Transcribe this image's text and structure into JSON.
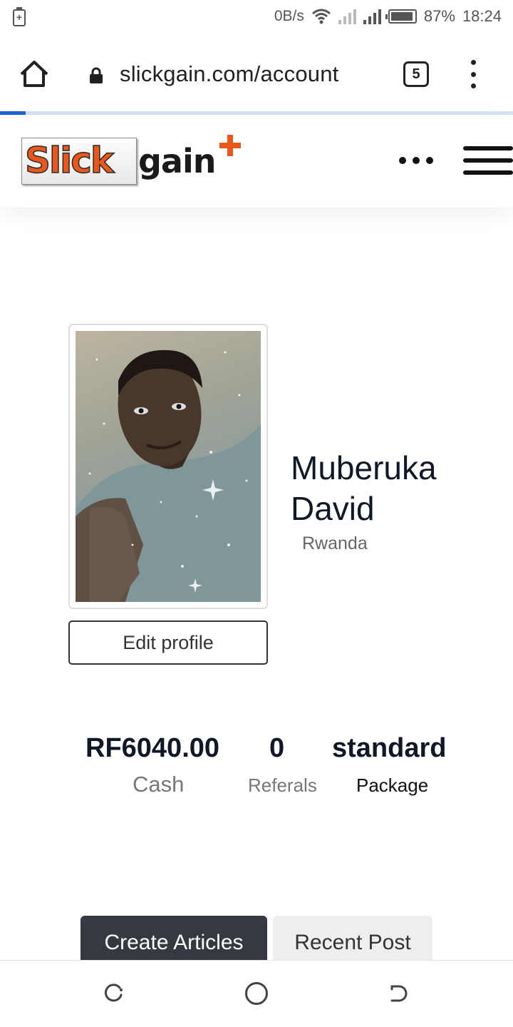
{
  "status_bar": {
    "battery_left_glyph": "+",
    "net_speed": "0B/s",
    "battery_pct": "87%",
    "time": "18:24"
  },
  "browser": {
    "url": "slickgain.com/account",
    "tab_count": "5",
    "load_progress": 0.05
  },
  "site": {
    "logo_part1": "Slick",
    "logo_part2": "gain",
    "brand_color": "#e8581c"
  },
  "profile": {
    "name": "Muberuka David",
    "country": "Rwanda",
    "edit_label": "Edit profile"
  },
  "stats": {
    "cash_value": "RF6040.00",
    "cash_label": "Cash",
    "referals_value": "0",
    "referals_label": "Referals",
    "package_value": "standard",
    "package_label": "Package"
  },
  "tabs": {
    "create": "Create Articles",
    "recent": "Recent Post"
  },
  "icons": {
    "home": "home-icon",
    "lock": "lock-icon",
    "menu": "kebab-menu-icon",
    "more": "more-dots-icon",
    "hamburger": "hamburger-icon"
  }
}
